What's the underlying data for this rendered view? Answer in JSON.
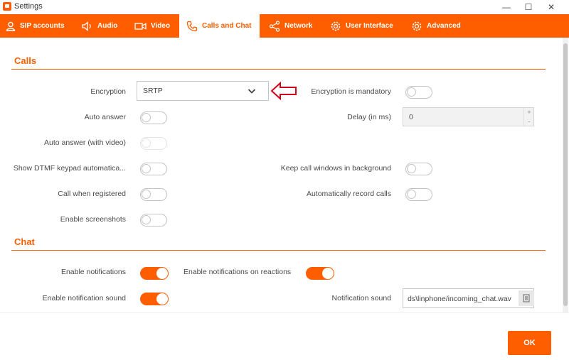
{
  "window": {
    "title": "Settings"
  },
  "tabs": [
    {
      "label": "SIP accounts",
      "icon": "user-icon"
    },
    {
      "label": "Audio",
      "icon": "speaker-icon"
    },
    {
      "label": "Video",
      "icon": "camera-icon"
    },
    {
      "label": "Calls and Chat",
      "icon": "phone-icon",
      "active": true
    },
    {
      "label": "Network",
      "icon": "share-icon"
    },
    {
      "label": "User Interface",
      "icon": "gear-icon"
    },
    {
      "label": "Advanced",
      "icon": "gear-icon"
    }
  ],
  "calls": {
    "title": "Calls",
    "encryption_label": "Encryption",
    "encryption_value": "SRTP",
    "encryption_mandatory_label": "Encryption is mandatory",
    "auto_answer_label": "Auto answer",
    "delay_label": "Delay (in ms)",
    "delay_value": "0",
    "auto_answer_video_label": "Auto answer (with video)",
    "show_dtmf_label": "Show DTMF keypad automatica...",
    "keep_windows_label": "Keep call windows in background",
    "call_when_registered_label": "Call when registered",
    "auto_record_label": "Automatically record calls",
    "enable_screenshots_label": "Enable screenshots"
  },
  "chat": {
    "title": "Chat",
    "enable_notifications_label": "Enable notifications",
    "enable_notifications_reactions_label": "Enable notifications on reactions",
    "enable_notification_sound_label": "Enable notification sound",
    "notification_sound_label": "Notification sound",
    "notification_sound_value": "ds\\linphone/incoming_chat.wav"
  },
  "footer": {
    "ok_label": "OK"
  },
  "toggles": {
    "encryption_mandatory": false,
    "auto_answer": false,
    "auto_answer_video": false,
    "show_dtmf": false,
    "keep_windows": false,
    "call_when_registered": false,
    "auto_record": false,
    "enable_screenshots": false,
    "enable_notifications": true,
    "enable_notifications_reactions": true,
    "enable_notification_sound": true
  },
  "colors": {
    "accent": "#ff5e00",
    "annotation_arrow": "#d0021b"
  }
}
